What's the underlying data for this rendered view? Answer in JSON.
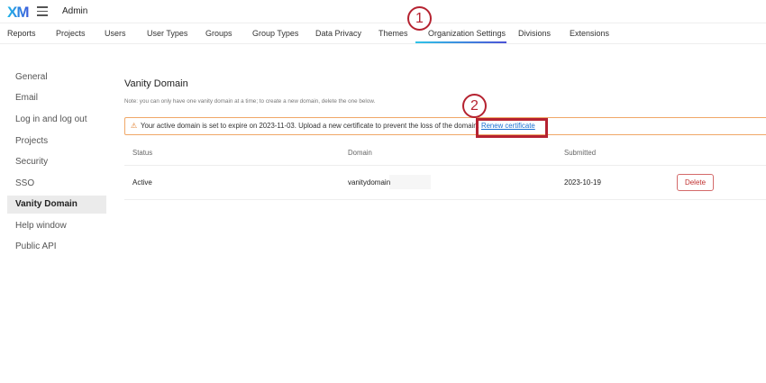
{
  "header": {
    "logo": "XM",
    "title": "Admin"
  },
  "tabs": [
    "Reports",
    "Projects",
    "Users",
    "User Types",
    "Groups",
    "Group Types",
    "Data Privacy",
    "Themes",
    "Organization Settings",
    "Divisions",
    "Extensions"
  ],
  "active_tab": "Organization Settings",
  "sidebar": [
    "General",
    "Email",
    "Log in and log out",
    "Projects",
    "Security",
    "SSO",
    "Vanity Domain",
    "Help window",
    "Public API"
  ],
  "active_sidebar": "Vanity Domain",
  "main": {
    "title": "Vanity Domain",
    "note": "Note: you can only have one vanity domain at a time; to create a new domain, delete the one below.",
    "banner": {
      "icon": "warning-icon",
      "text": "Your active domain is set to expire on 2023-11-03. Upload a new certificate to prevent the loss of the domain.",
      "link": "Renew certificate"
    },
    "table": {
      "headers": [
        "Status",
        "Domain",
        "Submitted"
      ],
      "rows": [
        {
          "status": "Active",
          "domain": "vanitydomain",
          "submitted": "2023-10-19",
          "action": "Delete"
        }
      ]
    }
  },
  "annotations": [
    "1",
    "2"
  ],
  "colors": {
    "accent": "#1a6fd1",
    "annotation": "#b52230",
    "warning": "#f0a868"
  }
}
